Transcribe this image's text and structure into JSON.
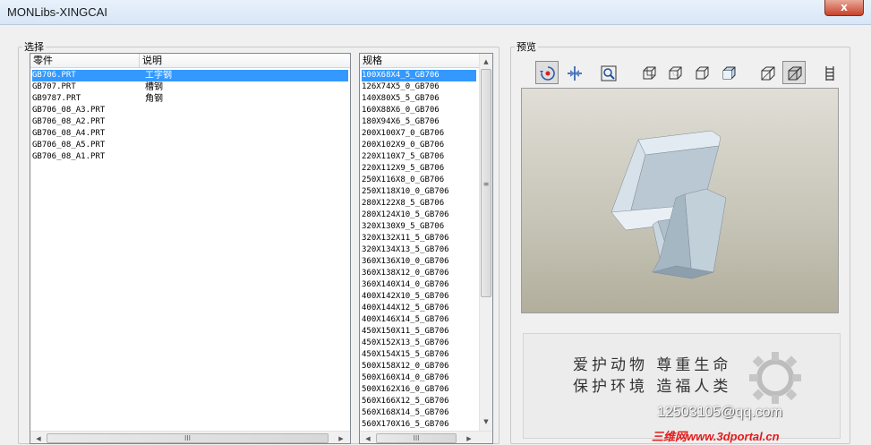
{
  "window": {
    "title": "MONLibs-XINGCAI",
    "close_glyph": "x"
  },
  "select_group": {
    "legend": "选择",
    "columns": {
      "part": "零件",
      "desc": "说明"
    },
    "parts": [
      "GB706.PRT",
      "GB707.PRT",
      "GB9787.PRT",
      "GB706_08_A3.PRT",
      "GB706_08_A2.PRT",
      "GB706_08_A4.PRT",
      "GB706_08_A5.PRT",
      "GB706_08_A1.PRT"
    ],
    "descriptions": [
      "工字钢",
      "槽钢",
      "角钢"
    ],
    "selected_index": 0,
    "spec_header": "规格",
    "specs": [
      "100X68X4_5_GB706",
      "126X74X5_0_GB706",
      "140X80X5_5_GB706",
      "160X88X6_0_GB706",
      "180X94X6_5_GB706",
      "200X100X7_0_GB706",
      "200X102X9_0_GB706",
      "220X110X7_5_GB706",
      "220X112X9_5_GB706",
      "250X116X8_0_GB706",
      "250X118X10_0_GB706",
      "280X122X8_5_GB706",
      "280X124X10_5_GB706",
      "320X130X9_5_GB706",
      "320X132X11_5_GB706",
      "320X134X13_5_GB706",
      "360X136X10_0_GB706",
      "360X138X12_0_GB706",
      "360X140X14_0_GB706",
      "400X142X10_5_GB706",
      "400X144X12_5_GB706",
      "400X146X14_5_GB706",
      "450X150X11_5_GB706",
      "450X152X13_5_GB706",
      "450X154X15_5_GB706",
      "500X158X12_0_GB706",
      "500X160X14_0_GB706",
      "500X162X16_0_GB706",
      "560X166X12_5_GB706",
      "560X168X14_5_GB706",
      "560X170X16_5_GB706"
    ],
    "spec_selected_index": 0
  },
  "preview_group": {
    "legend": "预览",
    "toolbar_icons": [
      "orient-icon",
      "spin-icon",
      "zoom-window-icon",
      "shaded-edges-icon",
      "hidden-line-icon",
      "no-hidden-icon",
      "shaded-icon",
      "wireframe-icon",
      "shaded-cube-icon",
      "more-icon"
    ],
    "active_toolbar": [
      0,
      6,
      8
    ]
  },
  "banner": {
    "slogan_line1": "爱护动物 尊重生命",
    "slogan_line2": "保护环境 造福人类",
    "email": "12503105@qq.com",
    "watermark": "三维网www.3dportal.cn"
  },
  "colors": {
    "selection": "#3399ff",
    "watermark": "#e51b1b"
  }
}
